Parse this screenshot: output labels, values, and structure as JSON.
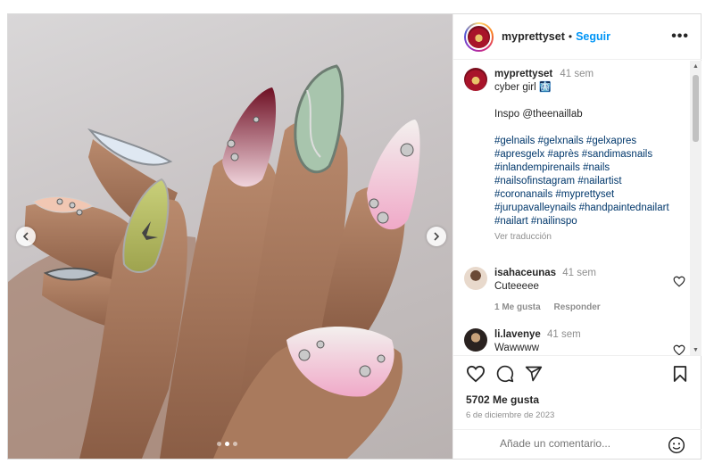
{
  "header": {
    "username": "myprettyset",
    "separator": "•",
    "follow_label": "Seguir",
    "more_label": "•••"
  },
  "caption": {
    "username": "myprettyset",
    "time": "41 sem",
    "lines": [
      "cyber girl 🩻",
      "",
      "Inspo @theenaillab",
      ""
    ],
    "hashtag_lines": [
      "#gelnails #gelxnails #gelxapres",
      "#apresgelx #après #sandimasnails",
      "#inlandempirenails #nails",
      "#nailsofinstagram #nailartist",
      "#coronanails #myprettyset",
      "#jurupavalleynails #handpaintednailart",
      "#nailart #nailinspo"
    ],
    "translate_label": "Ver traducción"
  },
  "comments": [
    {
      "username": "isahaceunas",
      "time": "41 sem",
      "text": "Cuteeeee",
      "likes_label": "1 Me gusta",
      "reply_label": "Responder"
    },
    {
      "username": "li.lavenye",
      "time": "41 sem",
      "text": "Wawwww"
    }
  ],
  "post": {
    "likes": "5702 Me gusta",
    "date": "6 de diciembre de 2023"
  },
  "add_comment": {
    "placeholder": "Añade un comentario..."
  },
  "carousel": {
    "total_slides": 3,
    "active_slide": 2
  },
  "icons": {
    "prev": "chevron-left-icon",
    "next": "chevron-right-icon",
    "like": "heart-icon",
    "comment": "comment-icon",
    "share": "share-icon",
    "save": "bookmark-icon",
    "emoji": "emoji-icon",
    "more": "more-icon"
  },
  "colors": {
    "link": "#0095f6",
    "hashtag": "#00376b",
    "muted": "#8e8e8e",
    "text": "#262626"
  }
}
